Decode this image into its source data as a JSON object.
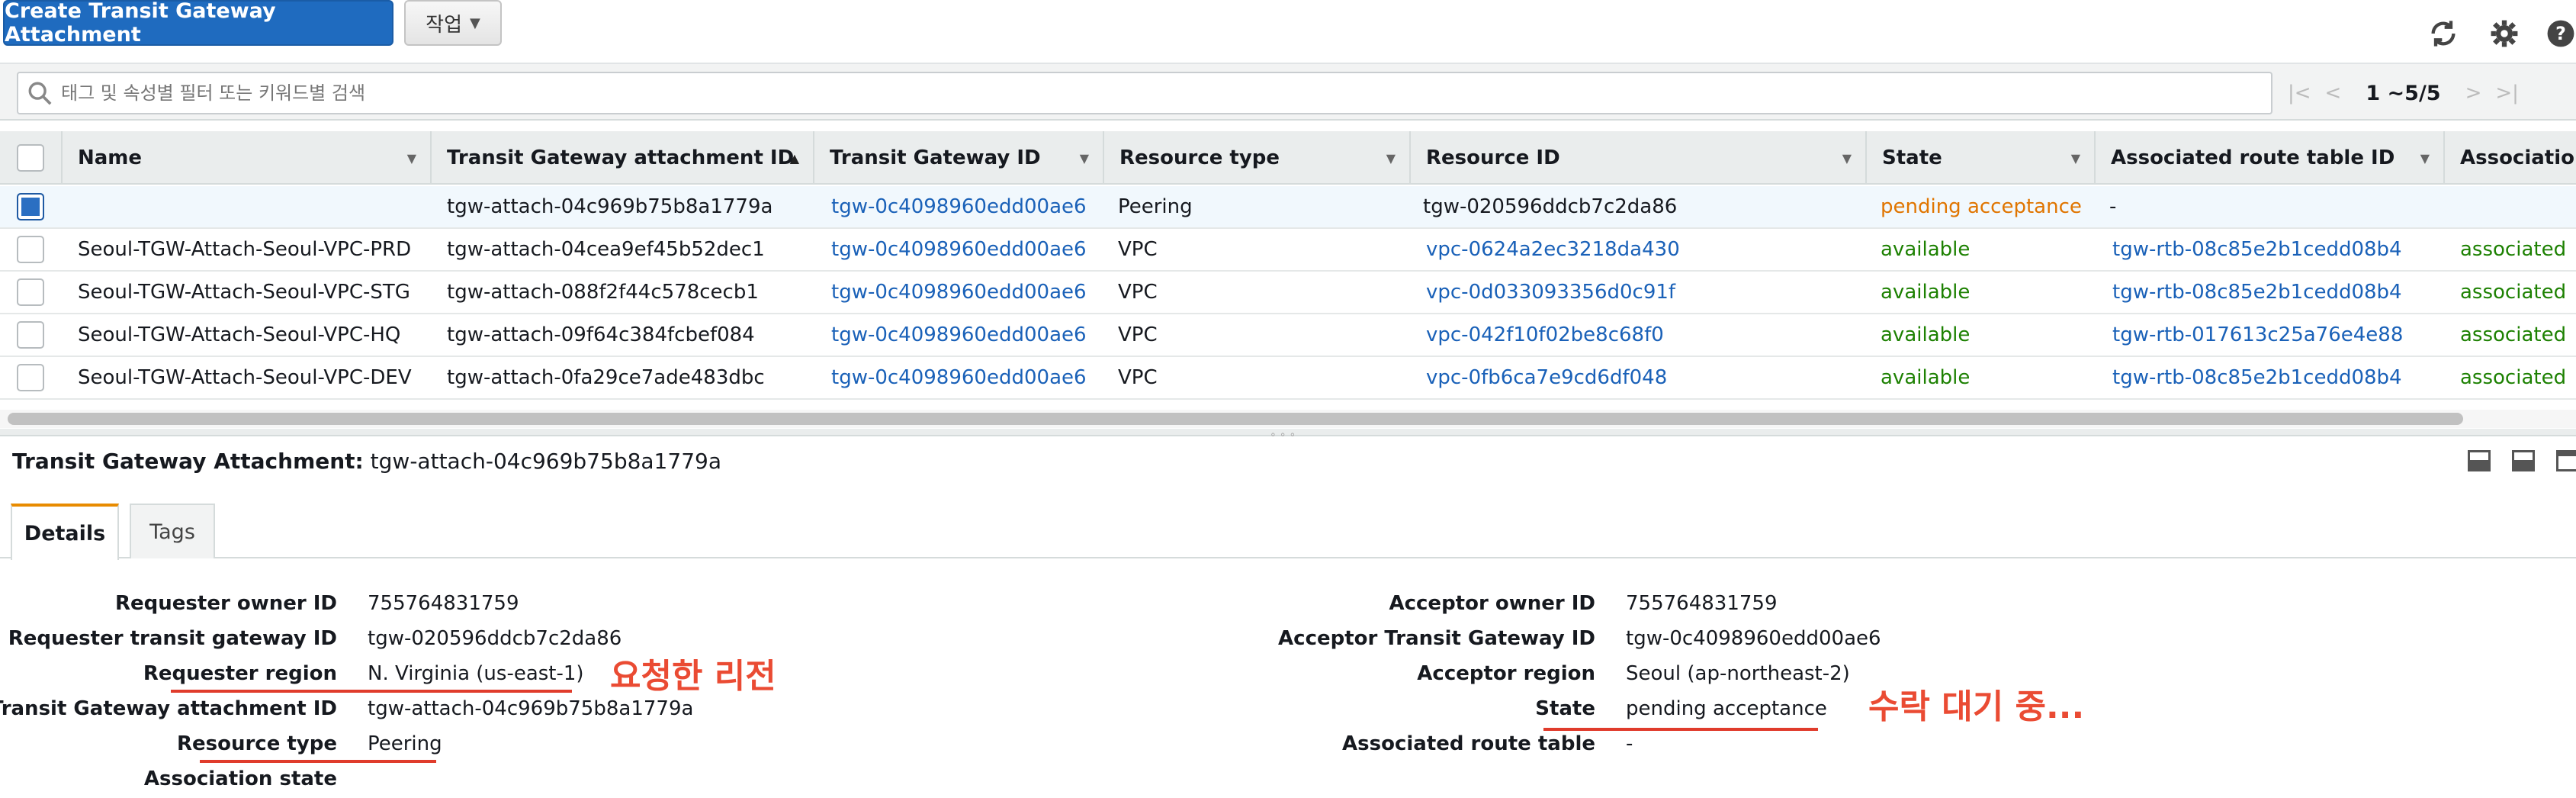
{
  "toolbar": {
    "create_label": "Create Transit Gateway Attachment",
    "action_label": "작업"
  },
  "search": {
    "placeholder": "태그 및 속성별 필터 또는 키워드별 검색",
    "range": "1 ~5/5"
  },
  "table": {
    "columns": [
      "Name",
      "Transit Gateway attachment ID",
      "Transit Gateway ID",
      "Resource type",
      "Resource ID",
      "State",
      "Associated route table ID",
      "Association"
    ],
    "rows": [
      {
        "name": "",
        "attachment_id": "tgw-attach-04c969b75b8a1779a",
        "tgw_id": "tgw-0c4098960edd00ae6",
        "resource_type": "Peering",
        "resource_id": "tgw-020596ddcb7c2da86",
        "state": "pending acceptance",
        "route_table": "-",
        "association": ""
      },
      {
        "name": "Seoul-TGW-Attach-Seoul-VPC-PRD",
        "attachment_id": "tgw-attach-04cea9ef45b52dec1",
        "tgw_id": "tgw-0c4098960edd00ae6",
        "resource_type": "VPC",
        "resource_id": "vpc-0624a2ec3218da430",
        "state": "available",
        "route_table": "tgw-rtb-08c85e2b1cedd08b4",
        "association": "associated"
      },
      {
        "name": "Seoul-TGW-Attach-Seoul-VPC-STG",
        "attachment_id": "tgw-attach-088f2f44c578cecb1",
        "tgw_id": "tgw-0c4098960edd00ae6",
        "resource_type": "VPC",
        "resource_id": "vpc-0d033093356d0c91f",
        "state": "available",
        "route_table": "tgw-rtb-08c85e2b1cedd08b4",
        "association": "associated"
      },
      {
        "name": "Seoul-TGW-Attach-Seoul-VPC-HQ",
        "attachment_id": "tgw-attach-09f64c384fcbef084",
        "tgw_id": "tgw-0c4098960edd00ae6",
        "resource_type": "VPC",
        "resource_id": "vpc-042f10f02be8c68f0",
        "state": "available",
        "route_table": "tgw-rtb-017613c25a76e4e88",
        "association": "associated"
      },
      {
        "name": "Seoul-TGW-Attach-Seoul-VPC-DEV",
        "attachment_id": "tgw-attach-0fa29ce7ade483dbc",
        "tgw_id": "tgw-0c4098960edd00ae6",
        "resource_type": "VPC",
        "resource_id": "vpc-0fb6ca7e9cd6df048",
        "state": "available",
        "route_table": "tgw-rtb-08c85e2b1cedd08b4",
        "association": "associated"
      }
    ]
  },
  "detail": {
    "title_label": "Transit Gateway Attachment:",
    "title_value": "tgw-attach-04c969b75b8a1779a",
    "tabs": [
      "Details",
      "Tags"
    ],
    "left": [
      {
        "label": "Requester owner ID",
        "value": "755764831759"
      },
      {
        "label": "Requester transit gateway ID",
        "value": "tgw-020596ddcb7c2da86"
      },
      {
        "label": "Requester region",
        "value": "N. Virginia (us-east-1)"
      },
      {
        "label": "Transit Gateway attachment ID",
        "value": "tgw-attach-04c969b75b8a1779a"
      },
      {
        "label": "Resource type",
        "value": "Peering"
      },
      {
        "label": "Association state",
        "value": ""
      }
    ],
    "right": [
      {
        "label": "Acceptor owner ID",
        "value": "755764831759"
      },
      {
        "label": "Acceptor Transit Gateway ID",
        "value": "tgw-0c4098960edd00ae6"
      },
      {
        "label": "Acceptor region",
        "value": "Seoul (ap-northeast-2)"
      },
      {
        "label": "State",
        "value": "pending acceptance"
      },
      {
        "label": "Associated route table",
        "value": "-"
      }
    ]
  },
  "annotations": {
    "requester_region": "요청한 리전",
    "pending": "수락 대기 중..."
  },
  "colors": {
    "primary": "#1f6bbf",
    "link": "#1a61b8",
    "available": "#1d8102",
    "pending": "#e07500",
    "annotation": "#ea4b33"
  }
}
